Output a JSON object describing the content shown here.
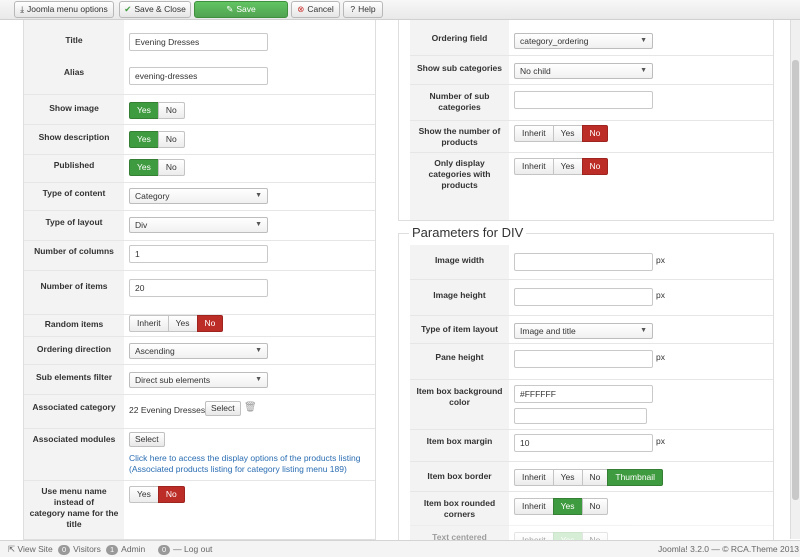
{
  "toolbar": {
    "menu_options": "Joomla menu options",
    "save_close": "Save & Close",
    "save": "Save",
    "cancel": "Cancel",
    "help": "Help"
  },
  "left": {
    "title": {
      "label": "Title",
      "value": "Evening Dresses"
    },
    "alias": {
      "label": "Alias",
      "value": "evening-dresses"
    },
    "show_image": {
      "label": "Show image",
      "options": [
        "Yes",
        "No"
      ],
      "selected": "Yes"
    },
    "show_description": {
      "label": "Show description",
      "options": [
        "Yes",
        "No"
      ],
      "selected": "Yes"
    },
    "published": {
      "label": "Published",
      "options": [
        "Yes",
        "No"
      ],
      "selected": "Yes"
    },
    "type_of_content": {
      "label": "Type of content",
      "value": "Category"
    },
    "type_of_layout": {
      "label": "Type of layout",
      "value": "Div"
    },
    "number_of_columns": {
      "label": "Number of columns",
      "value": "1"
    },
    "number_of_items": {
      "label": "Number of items",
      "value": "20"
    },
    "random_items": {
      "label": "Random items",
      "options": [
        "Inherit",
        "Yes",
        "No"
      ],
      "selected": "No"
    },
    "ordering_direction": {
      "label": "Ordering direction",
      "value": "Ascending"
    },
    "sub_elements_filter": {
      "label": "Sub elements filter",
      "value": "Direct sub elements"
    },
    "associated_category": {
      "label": "Associated category",
      "value": "22 Evening Dresses",
      "button": "Select"
    },
    "associated_modules": {
      "label": "Associated modules",
      "button": "Select",
      "link_line1": "Click here to access the display options of the products listing",
      "link_line2": "(Associated products listing for category listing menu 189)"
    },
    "use_menu_name": {
      "label_line1": "Use menu name",
      "label_line2": "instead of",
      "label_line3": "category name for the",
      "label_line4": "title",
      "options": [
        "Yes",
        "No"
      ],
      "selected": "No"
    }
  },
  "right_top": {
    "ordering_field": {
      "label": "Ordering field",
      "value": "category_ordering"
    },
    "show_sub_categories": {
      "label": "Show sub categories",
      "value": "No child"
    },
    "number_of_sub_categories": {
      "label_line1": "Number of sub",
      "label_line2": "categories",
      "value": ""
    },
    "show_number_of_products": {
      "label_line1": "Show the number of",
      "label_line2": "products",
      "options": [
        "Inherit",
        "Yes",
        "No"
      ],
      "selected": "No"
    },
    "only_display": {
      "label_line1": "Only display",
      "label_line2": "categories with",
      "label_line3": "products",
      "options": [
        "Inherit",
        "Yes",
        "No"
      ],
      "selected": "No"
    }
  },
  "right_bottom": {
    "legend": "Parameters for DIV",
    "image_width": {
      "label": "Image width",
      "value": "",
      "unit": "px"
    },
    "image_height": {
      "label": "Image height",
      "value": "",
      "unit": "px"
    },
    "type_of_item_layout": {
      "label": "Type of item layout",
      "value": "Image and title"
    },
    "pane_height": {
      "label": "Pane height",
      "value": "",
      "unit": "px"
    },
    "item_box_bg_color": {
      "label_line1": "Item box background",
      "label_line2": "color",
      "value": "#FFFFFF",
      "value2": ""
    },
    "item_box_margin": {
      "label": "Item box margin",
      "value": "10",
      "unit": "px"
    },
    "item_box_border": {
      "label": "Item box border",
      "options": [
        "Inherit",
        "Yes",
        "No",
        "Thumbnail"
      ],
      "selected": "Thumbnail"
    },
    "item_box_rounded": {
      "label_line1": "Item box rounded",
      "label_line2": "corners",
      "options": [
        "Inherit",
        "Yes",
        "No"
      ],
      "selected": "Yes"
    },
    "text_centered": {
      "label": "Text centered",
      "options": [
        "Inherit",
        "Yes",
        "No"
      ],
      "selected": "Yes"
    }
  },
  "statusbar": {
    "view_site": "View Site",
    "visitors_count": "0",
    "visitors": "Visitors",
    "admin_count": "1",
    "admin": "Admin",
    "logout_count": "0",
    "logout": "Log out",
    "version": "Joomla! 3.2.0",
    "copyright": "— © RCA.Theme 2013"
  },
  "colors": {
    "green": "#3f9b3f",
    "red": "#bd2d28",
    "link": "#2a6db2"
  }
}
